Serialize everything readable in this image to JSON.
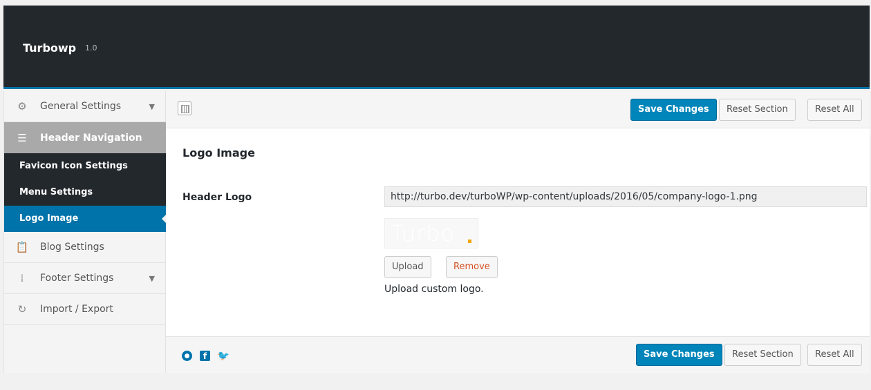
{
  "app": {
    "title": "Turbowp",
    "version": "1.0"
  },
  "sidebar": {
    "items": [
      {
        "label": "General Settings",
        "icon": "gears-icon",
        "has_chevron": true
      },
      {
        "label": "Header Navigation",
        "icon": "hamburger-icon",
        "active": true
      },
      {
        "label": "Blog Settings",
        "icon": "clipboard-icon"
      },
      {
        "label": "Footer Settings",
        "icon": "dots-grid-icon",
        "has_chevron": true
      },
      {
        "label": "Import / Export",
        "icon": "refresh-icon"
      }
    ],
    "subitems": [
      {
        "label": "Favicon Icon Settings"
      },
      {
        "label": "Menu Settings"
      },
      {
        "label": "Logo Image",
        "current": true
      }
    ]
  },
  "toolbar": {
    "save_label": "Save Changes",
    "reset_section_label": "Reset Section",
    "reset_all_label": "Reset All"
  },
  "content": {
    "section_title": "Logo Image",
    "field_label": "Header Logo",
    "logo_url": "http://turbo.dev/turboWP/wp-content/uploads/2016/05/company-logo-1.png",
    "logo_preview_text": "Turbo",
    "upload_label": "Upload",
    "remove_label": "Remove",
    "description": "Upload custom logo."
  },
  "footer": {
    "social": [
      "github-icon",
      "facebook-icon",
      "twitter-icon"
    ],
    "save_label": "Save Changes",
    "reset_section_label": "Reset Section",
    "reset_all_label": "Reset All"
  },
  "colors": {
    "accent": "#0073aa",
    "primary_button": "#0085ba",
    "header_bg": "#23282d",
    "remove_text": "#d54e21",
    "logo_dot": "#f0a500"
  }
}
